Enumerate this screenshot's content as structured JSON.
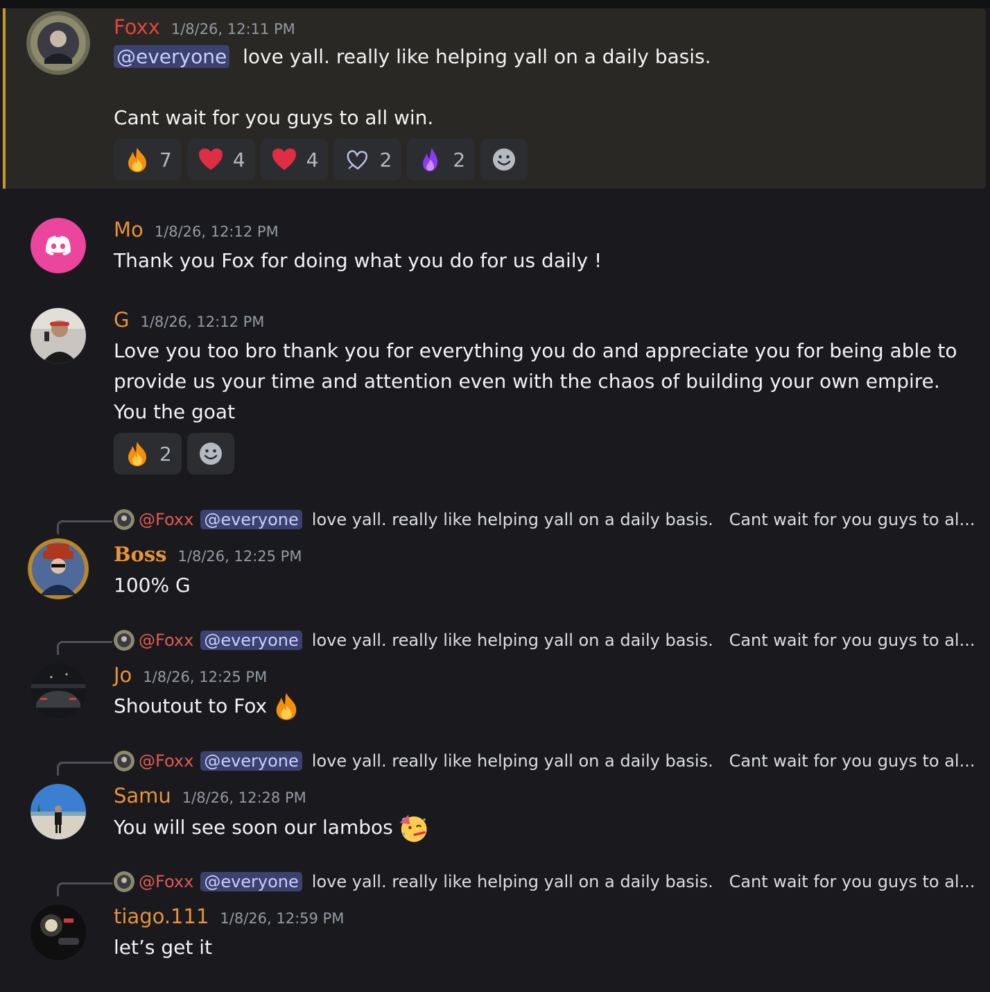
{
  "messages": [
    {
      "username": "Foxx",
      "timestamp": "1/8/26, 12:11 PM",
      "mention": "@everyone",
      "line1": "love yall. really like helping yall on a daily basis.",
      "line2": "Cant wait for you guys to all win.",
      "reactions": [
        {
          "emoji": "fire-emoji",
          "count": "7"
        },
        {
          "emoji": "red-heart-emoji",
          "count": "4"
        },
        {
          "emoji": "red-heart-emoji",
          "count": "4"
        },
        {
          "emoji": "outline-heart-emoji",
          "count": "2"
        },
        {
          "emoji": "purple-flame-emoji",
          "count": "2"
        }
      ]
    },
    {
      "username": "Mo",
      "timestamp": "1/8/26, 12:12 PM",
      "text": "Thank you Fox for doing what you do for us daily !"
    },
    {
      "username": "G",
      "timestamp": "1/8/26, 12:12 PM",
      "text": "Love you too bro thank you for everything you do and appreciate you for being able to provide us your time and attention even with the chaos of building your own empire. You the goat",
      "reactions": [
        {
          "emoji": "fire-emoji",
          "count": "2"
        }
      ]
    },
    {
      "username": "Boss",
      "timestamp": "1/8/26, 12:25 PM",
      "text": "100% G"
    },
    {
      "username": "Jo",
      "timestamp": "1/8/26, 12:25 PM",
      "text": "Shoutout to Fox"
    },
    {
      "username": "Samu",
      "timestamp": "1/8/26, 12:28 PM",
      "text": "You will see soon our lambos"
    },
    {
      "username": "tiago.111",
      "timestamp": "1/8/26, 12:59 PM",
      "text": "let’s get it"
    }
  ],
  "reply_preview": {
    "author": "@Foxx",
    "mention": "@everyone",
    "text": "love yall. really like helping yall on a daily basis.   Cant wait for you guys to al..."
  },
  "colors": {
    "foxx": "#e0453c",
    "orange_name": "#e8923a",
    "mention_bg": "#3c4270",
    "highlight_bg": "#2a2824",
    "highlight_bar": "#c9962e"
  }
}
